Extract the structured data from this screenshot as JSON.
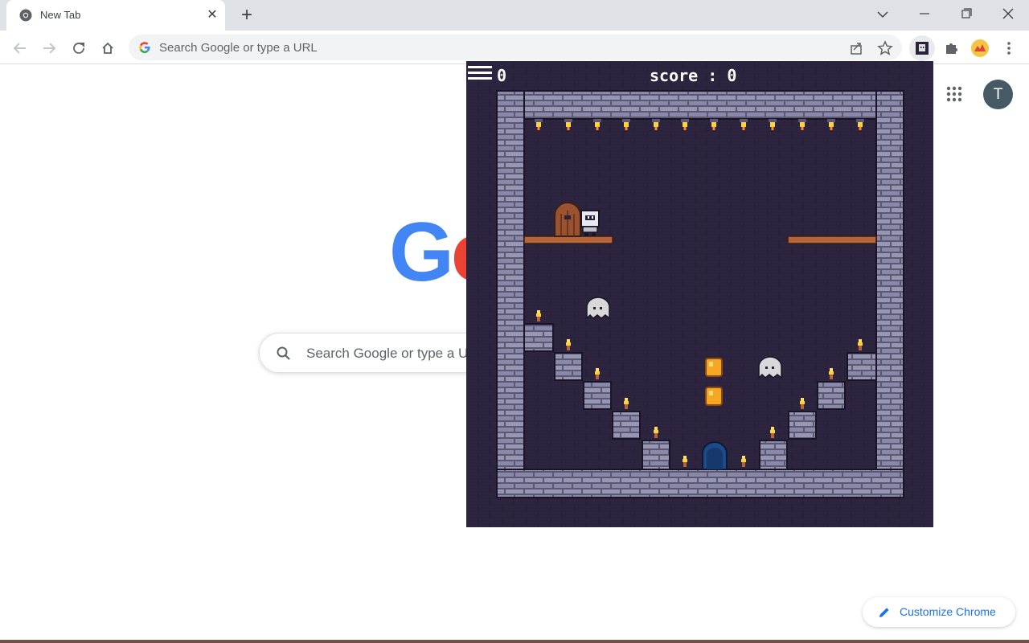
{
  "browser": {
    "tab": {
      "title": "New Tab",
      "favicon": "chrome-icon"
    },
    "omnibox": {
      "placeholder": "Search Google or type a URL"
    },
    "window_controls": [
      "chevron-down-icon",
      "minimize-icon",
      "restore-icon",
      "close-icon"
    ],
    "toolbar_icons": [
      "back-icon",
      "forward-icon",
      "reload-icon",
      "home-icon",
      "share-icon",
      "star-icon",
      "game-extension-icon",
      "puzzle-icon",
      "profile-extension-icon",
      "kebab-menu-icon"
    ]
  },
  "ntp": {
    "logo_visible": "Go",
    "search_placeholder": "Search Google or type a U",
    "avatar_initial": "T",
    "customize_label": "Customize Chrome"
  },
  "game": {
    "lives": "0",
    "score_label": "score : 0",
    "colors": {
      "background": "#2a2238",
      "brick": "#8a88a8",
      "platform": "#b5643a",
      "coin": "#f5a623",
      "door_exit": "#1f4a8a",
      "ghost": "#d8d8d8"
    }
  }
}
